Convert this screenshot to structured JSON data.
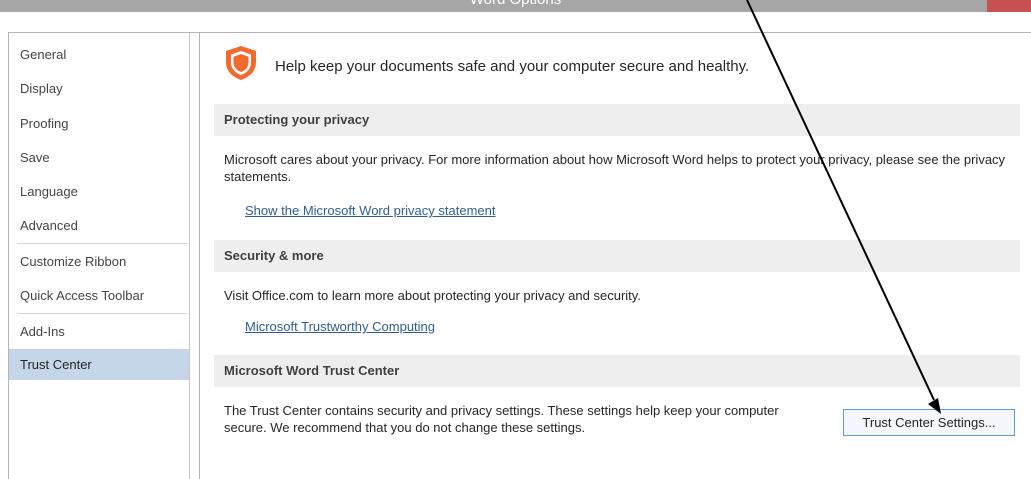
{
  "window": {
    "title": "Word Options"
  },
  "sidebar": {
    "items": [
      {
        "label": "General"
      },
      {
        "label": "Display"
      },
      {
        "label": "Proofing"
      },
      {
        "label": "Save"
      },
      {
        "label": "Language"
      },
      {
        "label": "Advanced"
      },
      {
        "label": "Customize Ribbon"
      },
      {
        "label": "Quick Access Toolbar"
      },
      {
        "label": "Add-Ins"
      },
      {
        "label": "Trust Center"
      }
    ],
    "selected": "Trust Center"
  },
  "main": {
    "intro": "Help keep your documents safe and your computer secure and healthy.",
    "icon": "shield-icon",
    "sections": [
      {
        "header": "Protecting your privacy",
        "text": "Microsoft cares about your privacy. For more information about how Microsoft Word helps to protect your privacy, please see the privacy statements.",
        "link": "Show the Microsoft Word privacy statement"
      },
      {
        "header": "Security & more",
        "text": "Visit Office.com to learn more about protecting your privacy and security.",
        "link": "Microsoft Trustworthy Computing"
      },
      {
        "header": "Microsoft Word Trust Center",
        "text": "The Trust Center contains security and privacy settings. These settings help keep your computer secure. We recommend that you do not change these settings.",
        "button_label": "Trust Center Settings..."
      }
    ]
  },
  "colors": {
    "selected_nav": "#c5d6e8",
    "link": "#2e5e96",
    "shield": "#f26a2e",
    "button_border": "#5b9bd5"
  }
}
